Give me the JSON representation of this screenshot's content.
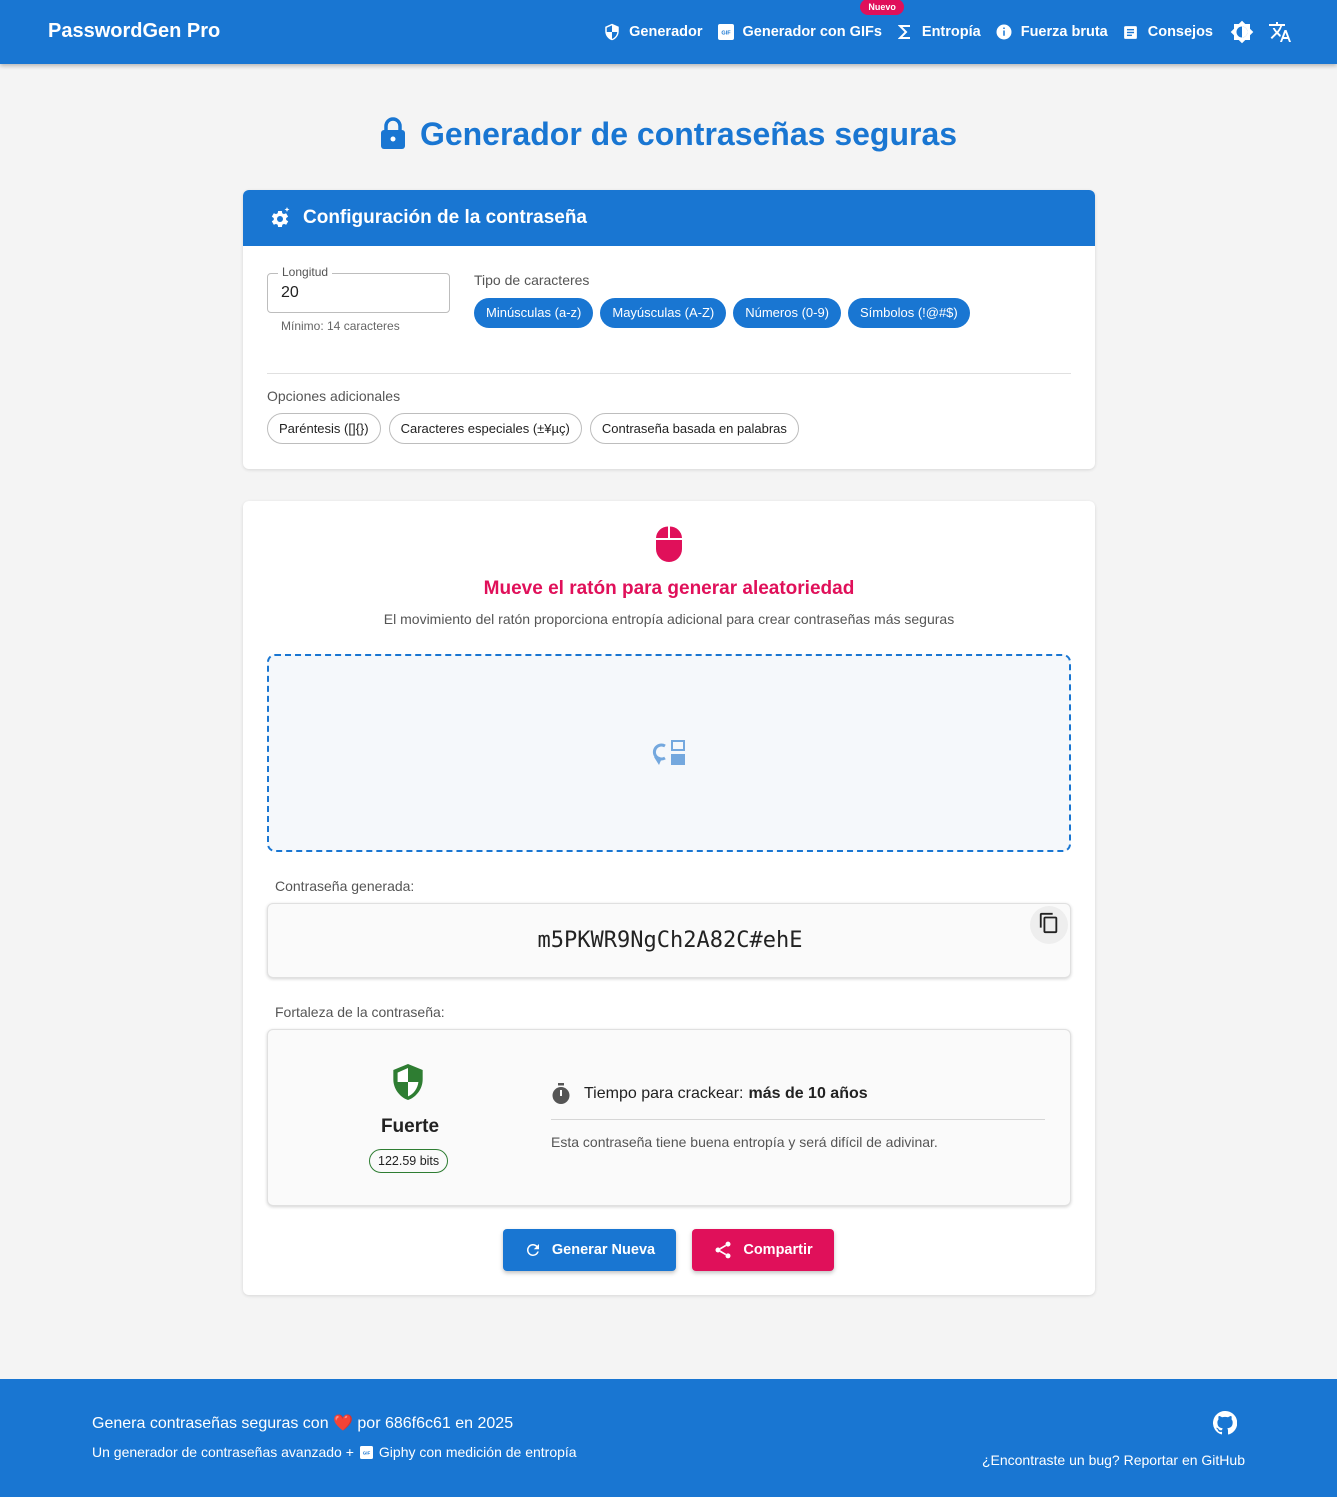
{
  "app": {
    "brand": "PasswordGen Pro"
  },
  "nav": {
    "items": [
      {
        "label": "Generador",
        "icon": "shield-icon"
      },
      {
        "label": "Generador con GIFs",
        "icon": "gif-icon",
        "badge": "Nuevo"
      },
      {
        "label": "Entropía",
        "icon": "sigma-icon"
      },
      {
        "label": "Fuerza bruta",
        "icon": "info-icon"
      },
      {
        "label": "Consejos",
        "icon": "article-icon"
      }
    ],
    "theme_icon": "brightness-icon",
    "language_icon": "translate-icon"
  },
  "page": {
    "title": "Generador de contraseñas seguras"
  },
  "config": {
    "header": "Configuración de la contraseña",
    "length": {
      "label": "Longitud",
      "value": "20",
      "helper": "Mínimo: 14 caracteres"
    },
    "char_types": {
      "label": "Tipo de caracteres",
      "options": [
        "Minúsculas (a-z)",
        "Mayúsculas (A-Z)",
        "Números (0-9)",
        "Símbolos (!@#$)"
      ]
    },
    "additional": {
      "label": "Opciones adicionales",
      "options": [
        "Paréntesis ([]{})",
        "Caracteres especiales (±¥µç)",
        "Contraseña basada en palabras"
      ]
    }
  },
  "entropy": {
    "title": "Mueve el ratón para generar aleatoriedad",
    "subtitle": "El movimiento del ratón proporciona entropía adicional para crear contraseñas más seguras"
  },
  "password": {
    "label": "Contraseña generada:",
    "value": "m5PKWR9NgCh2A82C#ehE"
  },
  "strength": {
    "label": "Fortaleza de la contraseña:",
    "level": "Fuerte",
    "bits": "122.59 bits",
    "crack_label": "Tiempo para crackear:",
    "crack_time": "más de 10 años",
    "description": "Esta contraseña tiene buena entropía y será difícil de adivinar."
  },
  "actions": {
    "generate": "Generar Nueva",
    "share": "Compartir"
  },
  "footer": {
    "line1": "Genera contraseñas seguras con ❤️ por 686f6c61 en 2025",
    "line2_prefix": "Un generador de contraseñas avanzado +",
    "line2_suffix": "Giphy con medición de entropía",
    "bug_link": "¿Encontraste un bug? Reportar en GitHub"
  },
  "colors": {
    "primary": "#1976d2",
    "accent": "#e0105a",
    "strong": "#2e7d32",
    "background": "#f4f4f4"
  }
}
